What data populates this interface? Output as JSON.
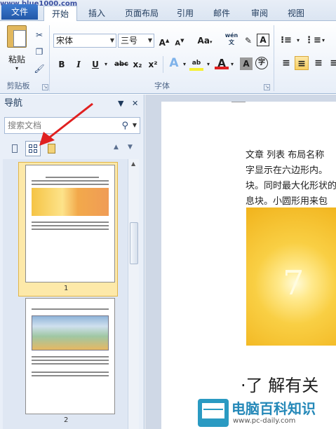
{
  "watermark_url": "www.blue1000.com",
  "tabs": {
    "file": "文件",
    "home": "开始",
    "insert": "插入",
    "page_layout": "页面布局",
    "references": "引用",
    "mailings": "邮件",
    "review": "审阅",
    "view": "视图"
  },
  "clipboard": {
    "paste_label": "粘贴",
    "group_label": "剪贴板"
  },
  "font": {
    "name": "宋体",
    "size": "三号",
    "group_label": "字体",
    "aa_label": "Aa",
    "grow_label": "A",
    "shrink_label": "A",
    "pinyin_label": "wén",
    "bold": "B",
    "italic": "I",
    "underline": "U",
    "strike": "abc",
    "sub": "x₂",
    "sup": "x²",
    "border_char": "A",
    "enclose_char": "字"
  },
  "nav": {
    "title": "导航",
    "search_placeholder": "搜索文档",
    "page1_num": "1",
    "page2_num": "2"
  },
  "document": {
    "line1": "文章 列表  布局名称",
    "line2": "字显示在六边形内。",
    "line3": "块。同时最大化形状的",
    "line4": "息块。小圆形用来包",
    "heading": "·了 解有关"
  },
  "logo": {
    "name": "电脑百科知识",
    "url": "www.pc-daily.com"
  },
  "colors": {
    "accent": "#2258a8",
    "highlight": "#f8cf63",
    "arrow": "#e02020"
  }
}
